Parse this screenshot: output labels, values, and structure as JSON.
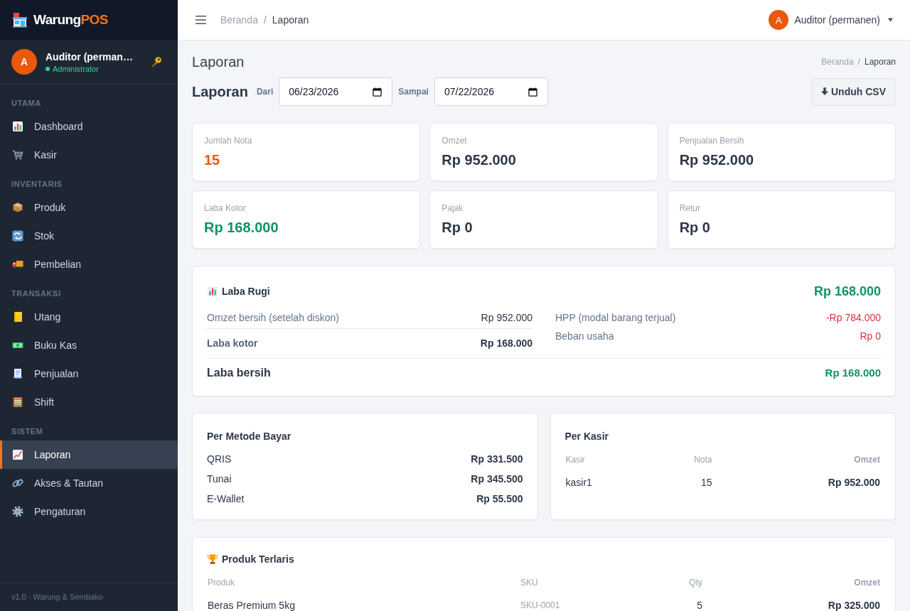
{
  "sidebar": {
    "brand": {
      "name": "Warung",
      "accent": "POS"
    },
    "user": {
      "initial": "A",
      "name": "Auditor (perman…",
      "role": "Administrator",
      "online": true
    },
    "sections": [
      {
        "title": "UTAMA",
        "items": [
          {
            "label": "Dashboard",
            "selected": false
          },
          {
            "label": "Kasir",
            "selected": false
          }
        ]
      },
      {
        "title": "INVENTARIS",
        "items": [
          {
            "label": "Produk",
            "selected": false
          },
          {
            "label": "Stok",
            "selected": false
          },
          {
            "label": "Pembelian",
            "selected": false
          }
        ]
      },
      {
        "title": "TRANSAKSI",
        "items": [
          {
            "label": "Utang",
            "selected": false
          },
          {
            "label": "Buku Kas",
            "selected": false
          },
          {
            "label": "Penjualan",
            "selected": false
          },
          {
            "label": "Shift",
            "selected": false
          }
        ]
      },
      {
        "title": "SISTEM",
        "items": [
          {
            "label": "Laporan",
            "selected": true
          },
          {
            "label": "Akses & Tautan",
            "selected": false
          },
          {
            "label": "Pengaturan",
            "selected": false
          }
        ]
      }
    ],
    "footer": "v1.0 · Warung & Sembako"
  },
  "topbar": {
    "breadcrumb": {
      "items": [
        "Beranda",
        "Laporan"
      ],
      "separator": "/"
    },
    "user": {
      "initial": "A",
      "name": "Auditor (permanen)"
    }
  },
  "page": {
    "title": "Laporan",
    "breadcrumb": {
      "items": [
        "Beranda",
        "Laporan"
      ],
      "separator": "/"
    },
    "filter": {
      "heading": "Laporan",
      "from": {
        "label": "Dari",
        "value": "06/23/2026"
      },
      "to": {
        "label": "Sampai",
        "value": "07/22/2026"
      },
      "button": "Unduh CSV"
    }
  },
  "stats": [
    {
      "label": "Jumlah Nota",
      "value": "15",
      "color": "#e8590c"
    },
    {
      "label": "Omzet",
      "value": "Rp 952.000",
      "color": "#2d3748"
    },
    {
      "label": "Penjualan Bersih",
      "value": "Rp 952.000",
      "color": "#2d3748"
    },
    {
      "label": "Laba Kotor",
      "value": "Rp 168.000",
      "color": "#0d9463"
    },
    {
      "label": "Pajak",
      "value": "Rp 0",
      "color": "#2d3748"
    },
    {
      "label": "Retur",
      "value": "Rp 0",
      "color": "#2d3748"
    }
  ],
  "profit_loss": {
    "title": "Laba Rugi",
    "total": "Rp 168.000",
    "left": [
      {
        "label": "Omzet bersih (setelah diskon)",
        "value": "Rp 952.000",
        "kind": "item"
      },
      {
        "label": "Laba kotor",
        "value": "Rp 168.000",
        "kind": "subtotal"
      }
    ],
    "right": [
      {
        "label": "HPP (modal barang terjual)",
        "value": "-Rp 784.000",
        "kind": "deduction"
      },
      {
        "label": "Beban usaha",
        "value": "Rp 0",
        "kind": "deduction"
      }
    ],
    "net": {
      "label": "Laba bersih",
      "value": "Rp 168.000"
    }
  },
  "payment_methods": {
    "title": "Per Metode Bayar",
    "rows": [
      {
        "label": "QRIS",
        "value": "Rp 331.500"
      },
      {
        "label": "Tunai",
        "value": "Rp 345.500"
      },
      {
        "label": "E-Wallet",
        "value": "Rp 55.500"
      }
    ]
  },
  "cashiers": {
    "title": "Per Kasir",
    "columns": [
      "Kasir",
      "Nota",
      "Omzet"
    ],
    "rows": [
      [
        "kasir1",
        "15",
        "Rp 952.000"
      ]
    ]
  },
  "top_products": {
    "title": "Produk Terlaris",
    "columns": [
      "Produk",
      "SKU",
      "Qty",
      "Omzet"
    ],
    "rows": [
      [
        "Beras Premium 5kg",
        "SKU-0001",
        "5",
        "Rp 325.000"
      ]
    ]
  }
}
